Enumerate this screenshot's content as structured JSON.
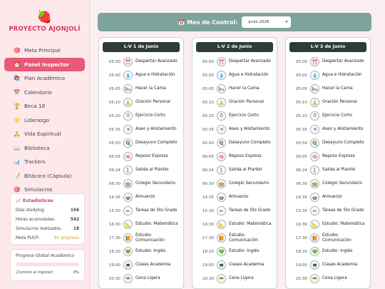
{
  "brand": {
    "icon": "strawberry-icon",
    "icon_glyph": "🍓",
    "name": "PROYECTO AJONJOLÍ"
  },
  "nav": [
    {
      "label": "Meta Principal",
      "icon": "target-icon",
      "glyph": "🎯",
      "active": false
    },
    {
      "label": "Panel Inspector",
      "icon": "alarm-clock-icon",
      "glyph": "⏰",
      "active": true
    },
    {
      "label": "Plan Académico",
      "icon": "books-icon",
      "glyph": "📚",
      "active": false
    },
    {
      "label": "Calendario",
      "icon": "calendar-icon",
      "glyph": "📅",
      "active": false
    },
    {
      "label": "Beca 18",
      "icon": "trophy-icon",
      "glyph": "🏆",
      "active": false
    },
    {
      "label": "Liderazgo",
      "icon": "star-icon",
      "glyph": "🌟",
      "active": false
    },
    {
      "label": "Vida Espiritual",
      "icon": "praying-hands-icon",
      "glyph": "🙏",
      "active": false
    },
    {
      "label": "Biblioteca",
      "icon": "book-icon",
      "glyph": "📖",
      "active": false
    },
    {
      "label": "Trackers",
      "icon": "chart-icon",
      "glyph": "📊",
      "active": false
    },
    {
      "label": "Bitácora (Cápsula)",
      "icon": "memo-icon",
      "glyph": "📝",
      "active": false
    },
    {
      "label": "Simulacros",
      "icon": "target-icon",
      "glyph": "🎯",
      "active": false
    }
  ],
  "stats": {
    "title": "📈 Estadísticas",
    "rows": [
      {
        "label": "Días studying:",
        "value": "156"
      },
      {
        "label": "Horas acumuladas:",
        "value": "542"
      },
      {
        "label": "Simulacros realizados:",
        "value": "18"
      },
      {
        "label": "Meta PUCP:",
        "value": "En progreso"
      }
    ]
  },
  "progress": {
    "title": "Progreso Global Académico",
    "fraction": 0,
    "message": "¡Comino al ingreso!",
    "percent_text": "0%"
  },
  "header": {
    "label": "📅 Mes de Control:",
    "selected_month": "Junio 2026",
    "chevron": "chevron-down-icon"
  },
  "schedule": [
    {
      "label": "Despertar Avanzado",
      "icon": "alarm-clock-icon",
      "glyph": "⏰"
    },
    {
      "label": "Agua e Hidratación",
      "icon": "water-drop-icon",
      "glyph": "💧"
    },
    {
      "label": "Hacer la Cama",
      "icon": "bed-icon",
      "glyph": "🛏"
    },
    {
      "label": "Oración Personal",
      "icon": "praying-hands-icon",
      "glyph": "🙏"
    },
    {
      "label": "Ejercicio Corto",
      "icon": "stopwatch-icon",
      "glyph": "⏱"
    },
    {
      "label": "Aseo y Alistamiento",
      "icon": "shower-icon",
      "glyph": "🚿"
    },
    {
      "label": "Desayuno Completo",
      "icon": "plate-icon",
      "glyph": "🍳"
    },
    {
      "label": "Reposo Express",
      "icon": "brain-icon",
      "glyph": "🧠"
    },
    {
      "label": "Salida al Plantel",
      "icon": "walking-icon",
      "glyph": "🚶"
    },
    {
      "label": "Colegio Secundario",
      "icon": "school-icon",
      "glyph": "🏫"
    },
    {
      "label": "Almuerzo",
      "icon": "bowl-icon",
      "glyph": "🍲"
    },
    {
      "label": "Tareas de 5to Grado",
      "icon": "pencil-icon",
      "glyph": "✏"
    },
    {
      "label": "Estudio: Matemática",
      "icon": "ruler-icon",
      "glyph": "📐"
    },
    {
      "label": "Estudio: Comunicación",
      "icon": "notebook-icon",
      "glyph": "📙"
    },
    {
      "label": "Estudio: Inglés",
      "icon": "green-heart-icon",
      "glyph": "💚"
    },
    {
      "label": "Clases Academia",
      "icon": "laptop-icon",
      "glyph": "💻"
    },
    {
      "label": "Cena Ligera",
      "icon": "salad-icon",
      "glyph": "🥗"
    }
  ],
  "days": [
    {
      "title": "L-V 1 de Junio",
      "times": [
        "05:00",
        "05:00",
        "05:05",
        "05:10",
        "05:20",
        "05:35",
        "05:50",
        "06:05",
        "06:24",
        "06:30",
        "14:35",
        "15:30",
        "16:30",
        "17:30",
        "18:20",
        "19:00",
        "20:30"
      ]
    },
    {
      "title": "L-V 2 de Junio",
      "times": [
        "05:00",
        "05:00",
        "05:05",
        "05:10",
        "05:20",
        "05:35",
        "05:50",
        "06:05",
        "06:24",
        "06:30",
        "14:35",
        "15:30",
        "16:30",
        "17:30",
        "18:20",
        "19:00",
        "20:30"
      ]
    },
    {
      "title": "L-V 3 de Junio",
      "times": [
        "05:00",
        "05:00",
        "05:05",
        "05:10",
        "05:20",
        "05:35",
        "05:50",
        "06:05",
        "06:24",
        "06:30",
        "14:35",
        "15:30",
        "16:30",
        "17:30",
        "18:20",
        "19:00",
        "20:30"
      ]
    }
  ]
}
